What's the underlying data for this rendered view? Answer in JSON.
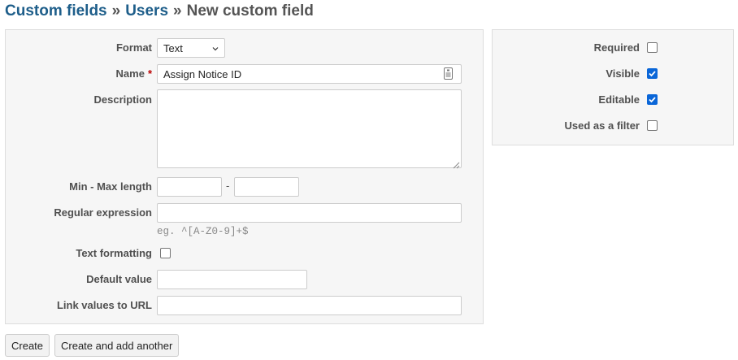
{
  "breadcrumb": {
    "root": "Custom fields",
    "separator": "»",
    "section": "Users",
    "current": "New custom field"
  },
  "form": {
    "format": {
      "label": "Format",
      "value": "Text"
    },
    "name": {
      "label": "Name",
      "required_mark": "*",
      "value": "Assign Notice ID"
    },
    "description": {
      "label": "Description",
      "value": ""
    },
    "length": {
      "label": "Min - Max length",
      "separator": "-",
      "min": "",
      "max": ""
    },
    "regex": {
      "label": "Regular expression",
      "value": "",
      "hint": "eg. ^[A-Z0-9]+$"
    },
    "text_formatting": {
      "label": "Text formatting",
      "checked": false
    },
    "default_value": {
      "label": "Default value",
      "value": ""
    },
    "link_values": {
      "label": "Link values to URL",
      "value": ""
    }
  },
  "options": {
    "required": {
      "label": "Required",
      "checked": false
    },
    "visible": {
      "label": "Visible",
      "checked": true
    },
    "editable": {
      "label": "Editable",
      "checked": true
    },
    "filter": {
      "label": "Used as a filter",
      "checked": false
    }
  },
  "buttons": {
    "create": "Create",
    "create_another": "Create and add another"
  },
  "colors": {
    "link": "#1e5e8a",
    "checkbox_checked": "#0a66d8",
    "required_mark": "#bb0000"
  },
  "icons": {
    "name_field": "keyboard-icon",
    "select": "chevron-down-icon",
    "textarea": "resize-grip-icon"
  }
}
